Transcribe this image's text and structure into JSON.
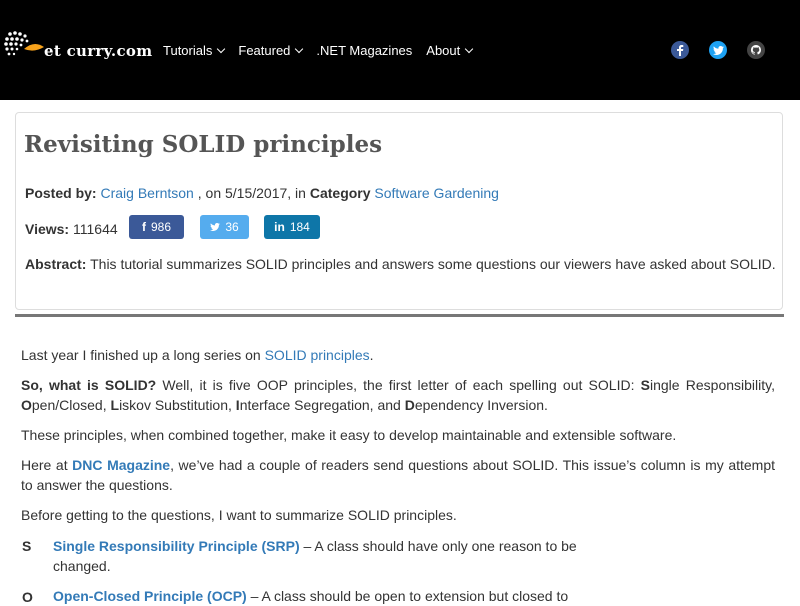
{
  "header": {
    "logo_text": "et curry.com",
    "nav": [
      "Tutorials",
      "Featured",
      ".NET Magazines",
      "About"
    ],
    "social": [
      "facebook-icon",
      "twitter-icon",
      "github-icon"
    ],
    "colors": {
      "bg": "#000000",
      "facebook": "#3b5998",
      "twitter": "#1da1f2"
    }
  },
  "article": {
    "title": "Revisiting SOLID principles",
    "posted_by_label": "Posted by:",
    "author": "Craig Berntson",
    "date_text": ", on 5/15/2017, in",
    "category_label": "Category",
    "category": "Software Gardening",
    "views_label": "Views:",
    "views": "111644",
    "shares": {
      "facebook": "986",
      "twitter": "36",
      "linkedin": "184"
    },
    "abstract_label": "Abstract:",
    "abstract": "This tutorial summarizes SOLID principles and answers some questions our viewers have asked about SOLID."
  },
  "body": {
    "p1_text": "Last year I finished up a long series on",
    "p1_link": "SOLID principles",
    "p1_end": ".",
    "p2_bold": "So, what is SOLID?",
    "p2_text": " Well, it is five OOP principles, the first letter of each spelling out SOLID: ",
    "p2_s": "S",
    "p2_s_rest": "ingle Responsibility, ",
    "p2_o": "O",
    "p2_o_rest": "pen/Closed, ",
    "p2_l": "L",
    "p2_l_rest": "iskov Substitution, ",
    "p2_i": "I",
    "p2_i_rest": "nterface Segregation, and ",
    "p2_d": "D",
    "p2_d_rest": "ependency Inversion.",
    "p3": "These principles, when combined together, make it easy to develop maintainable and extensible software.",
    "p4_start": "Here at",
    "p4_link": "DNC Magazine",
    "p4_rest": ", we’ve had a couple of readers send questions about SOLID. This issue’s column is my attempt to answer the questions.",
    "p5": "Before getting to the questions, I want to summarize SOLID principles.",
    "bullets": [
      {
        "letter": "S",
        "link": "Single Responsibility Principle (SRP)",
        "text": " – A class should have only one reason to be changed."
      },
      {
        "letter": "O",
        "link": "Open-Closed Principle (OCP)",
        "text": " – A class should be open to extension but closed to"
      }
    ]
  }
}
